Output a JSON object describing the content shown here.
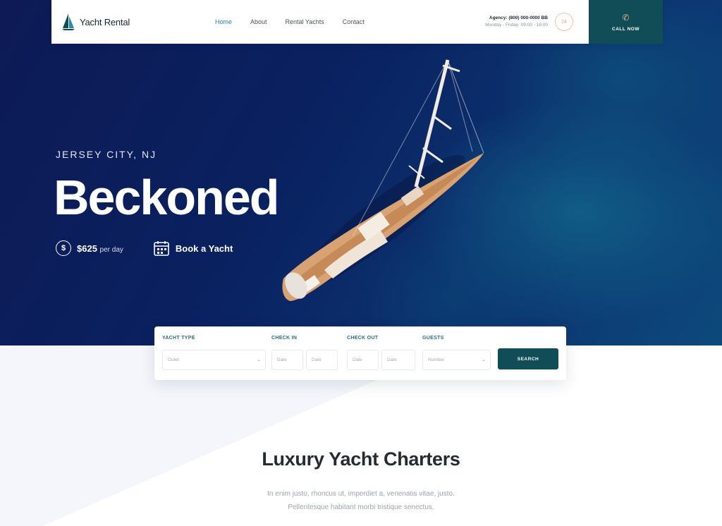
{
  "header": {
    "logo_text": "Yacht Rental",
    "nav": [
      {
        "label": "Home",
        "active": true
      },
      {
        "label": "About",
        "active": false
      },
      {
        "label": "Rental Yachts",
        "active": false
      },
      {
        "label": "Contact",
        "active": false
      }
    ],
    "contact_line1": "Agency: (800) 000-0000 BB",
    "contact_line2": "Monday - Friday: 09:00 - 19:00",
    "badge_text": "24",
    "call_label": "CALL NOW"
  },
  "hero": {
    "location": "JERSEY CITY, NJ",
    "headline": "Beckoned",
    "price_value": "$625",
    "price_unit": "per day",
    "book_label": "Book a Yacht"
  },
  "search": {
    "yacht_type_label": "YACHT TYPE",
    "yacht_type_value": "Gulet",
    "check_in_label": "CHECK IN",
    "check_out_label": "CHECK OUT",
    "guests_label": "GUESTS",
    "date_placeholder": "Date",
    "guests_value": "Number",
    "button_label": "SEARCH"
  },
  "section": {
    "title": "Luxury Yacht Charters",
    "description_line1": "In enim justo, rhoncus ut, imperdiet a, venenatis vitae, justo.",
    "description_line2": "Pellentesque habitant morbi tristique senectus."
  },
  "colors": {
    "primary": "#114d57",
    "accent": "#2b8aa5",
    "hero_bg": "#0a2160"
  }
}
